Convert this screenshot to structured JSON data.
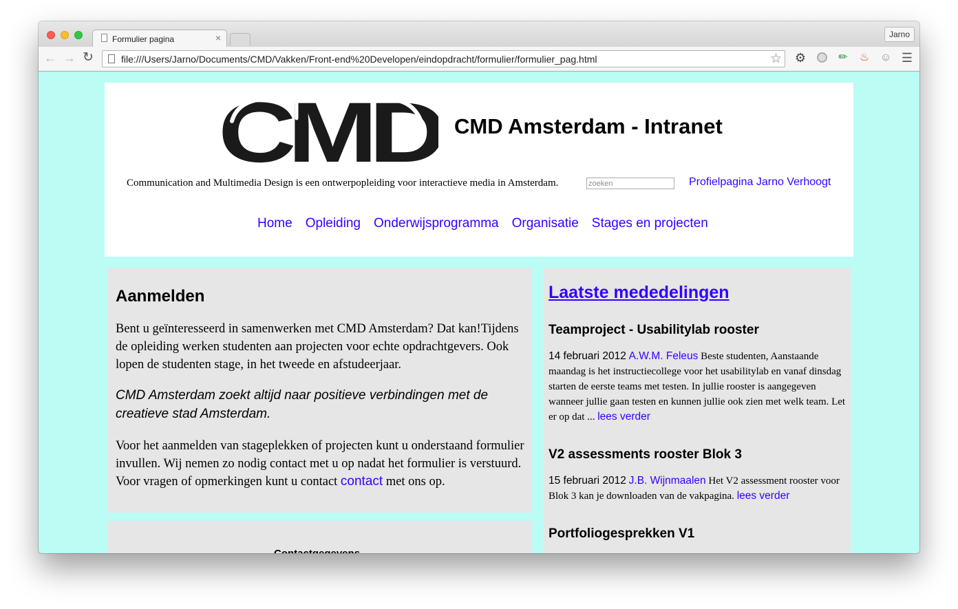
{
  "browser": {
    "tab_title": "Formulier pagina",
    "tab_close": "×",
    "profile_button": "Jarno",
    "url": "file:///Users/Jarno/Documents/CMD/Vakken/Front-end%20Developen/eindopdracht/formulier/formulier_pag.html",
    "icons": [
      "back-arrow-icon",
      "forward-arrow-icon",
      "reload-icon",
      "star-icon",
      "gear-icon",
      "circle-extension-icon",
      "eyedropper-icon",
      "fire-icon",
      "ghost-icon",
      "menu-icon"
    ]
  },
  "header": {
    "logo_text": "CMD",
    "title": "CMD Amsterdam - Intranet",
    "tagline": "Communication and Multimedia Design is een ontwerpopleiding voor interactieve media in Amsterdam.",
    "search_placeholder": "zoeken",
    "profile_link": "Profielpagina Jarno Verhoogt"
  },
  "nav": {
    "items": [
      "Home",
      "Opleiding",
      "Onderwijsprogramma",
      "Organisatie",
      "Stages en projecten"
    ]
  },
  "main": {
    "title": "Aanmelden",
    "paragraph1": "Bent u geïnteresseerd in samenwerken met CMD Amsterdam? Dat kan!Tijdens de opleiding werken studenten aan projecten voor echte opdrachtgevers. Ook lopen de studenten stage, in het tweede en afstudeerjaar.",
    "quote": "CMD Amsterdam zoekt altijd naar positieve verbindingen met de creatieve stad Amsterdam.",
    "paragraph3_before": "Voor het aanmelden van stageplekken of projecten kunt u onderstaand formulier invullen. Wij nemen zo nodig contact met u op nadat het formulier is verstuurd. Voor vragen of opmerkingen kunt u contact ",
    "paragraph3_link": "contact",
    "paragraph3_after": " met ons op.",
    "contact_heading": "Contactgegevens"
  },
  "sidebar": {
    "title": "Laatste mededelingen",
    "items": [
      {
        "heading": "Teamproject - Usabilitylab rooster",
        "date": "14 februari 2012",
        "author": "A.W.M. Feleus",
        "text": "Beste studenten, Aanstaande maandag is het instructiecollege voor het usabilitylab en vanaf dinsdag starten de eerste teams met testen. In jullie rooster is aangegeven wanneer jullie gaan testen en kunnen jullie ook zien met welk team. Let er op dat ...",
        "more": "lees verder"
      },
      {
        "heading": "V2 assessments rooster Blok 3",
        "date": "15 februari 2012",
        "author": "J.B. Wijnmaalen",
        "text": "Het V2 assessment rooster voor Blok 3 kan je downloaden van de vakpagina.",
        "more": "lees verder"
      },
      {
        "heading": "Portfoliogesprekken V1"
      }
    ]
  },
  "colors": {
    "page_background": "#bbfcf5",
    "panel_background": "#e6e6e6",
    "link": "#3300ff"
  }
}
